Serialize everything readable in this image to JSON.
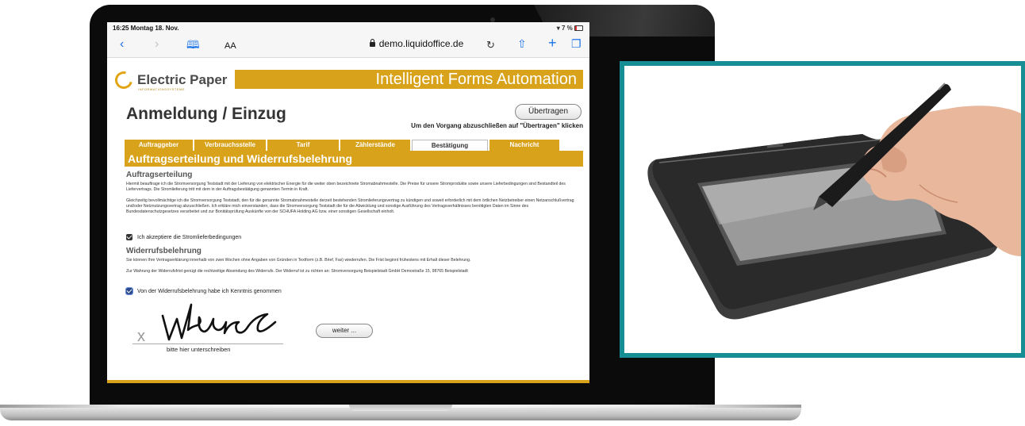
{
  "status_bar": {
    "time": "16:25  Montag 18. Nov.",
    "battery": "7 %"
  },
  "browser": {
    "back_icon": "chevron-left-icon",
    "forward_icon": "chevron-right-icon",
    "bookmarks_icon": "book-icon",
    "text_size_label": "AA",
    "url": "demo.liquidoffice.de",
    "reload_icon": "reload-icon",
    "share_icon": "share-icon",
    "new_tab_icon": "plus-icon",
    "tabs_icon": "tabs-icon"
  },
  "brand": {
    "name": "Electric Paper",
    "subtitle": "INFORMATIONSSYSTEME",
    "banner": "Intelligent Forms Automation",
    "accent_color": "#d8a21a"
  },
  "form": {
    "title": "Anmeldung / Einzug",
    "submit_label": "Übertragen",
    "submit_hint": "Um den Vorgang abzuschließen auf \"Übertragen\" klicken",
    "tabs": [
      {
        "label": "Auftraggeber"
      },
      {
        "label": "Verbrauchsstelle"
      },
      {
        "label": "Tarif"
      },
      {
        "label": "Zählerstände"
      },
      {
        "label": "Bestätigung",
        "active": true
      },
      {
        "label": "Nachricht"
      }
    ],
    "section_title": "Auftragserteilung und Widerrufsbelehrung",
    "auftrag": {
      "heading": "Auftragserteilung",
      "text_1": "Hiermit beauftrage ich die Stromversorgung Teststadt mit der Lieferung von elektrischer Energie für die weiter oben bezeichnete Stromabnahmestelle. Die Preise für unsere Stromprodukte sowie unsere Lieferbedingungen sind Bestandteil des Liefervertrags. Die Stromlieferung tritt mit dem in der Auftragsbestätigung genannten Termin in Kraft.",
      "text_2": "Gleichzeitig bevollmächtige ich die Stromversorgung Teststadt, den für die genannte Stromabnahmestelle derzeit bestehenden Stromlieferungsvertrag zu kündigen und soweit erforderlich mit dem örtlichen Netzbetreiber einen Netzanschlußvertrag und/oder Netznutzungsvertrag abzuschließen. Ich erkläre mich einverstanden, dass die Stromversorgung Teststadt die für die Abwicklung und sonstige Ausführung des Vertragsverhältnisses benötigten Daten im Sinne des Bundesdatenschutzgesetzes verarbeitet und zur Bonitätsprüfung Auskünfte von der SCHUFA Holding AG bzw. einer sonstigen Gesellschaft einholt.",
      "checkbox_label": "Ich akzeptiere die Stromlieferbedingungen",
      "checked": true
    },
    "widerruf": {
      "heading": "Widerrufsbelehrung",
      "text_1": "Sie können Ihre Vertragserklärung innerhalb von zwei Wochen ohne Angaben von Gründen in Textform (z.B. Brief, Fax) wiederrufen. Die Frist beginnt frühestens mit Erhalt dieser Belehrung.",
      "text_2": "Zur Wahrung der Widerrufsfrist genügt die rechtzeitige Absendung des Widerrufs. Der Widerruf ist zu richten an: Stromversorgung Beispielstadt GmbH Demostraße 15, 98765 Beispielstadt",
      "checkbox_label": "Von der Widerrufsbelehrung habe ich Kenntnis genommen",
      "checked": true
    },
    "signature": {
      "x_mark": "x",
      "label": "bitte hier unterschreiben"
    },
    "next_label": "weiter ..."
  }
}
